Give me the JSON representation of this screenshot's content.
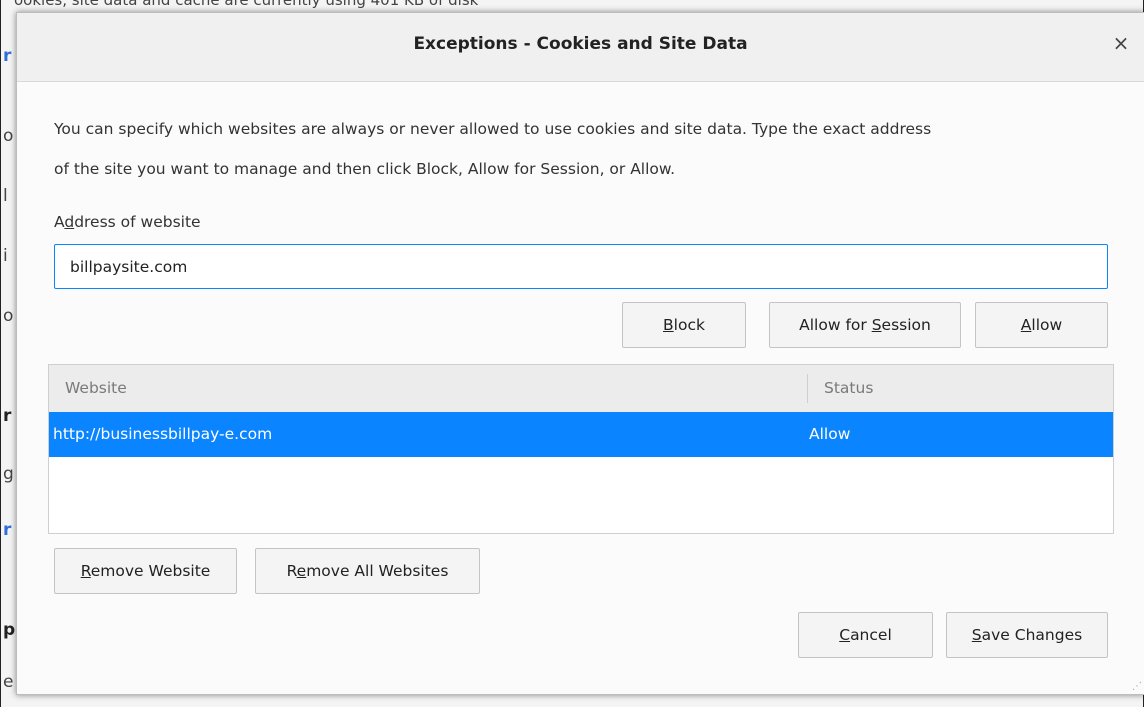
{
  "background": {
    "top_text": "ookies, site data and cache are currently using 401 KB of disk",
    "fragments": [
      "r",
      "o",
      "l",
      "i",
      "o",
      "r",
      "g",
      "r",
      "p",
      "e"
    ]
  },
  "dialog": {
    "title": "Exceptions - Cookies and Site Data",
    "close_glyph": "×",
    "description_line1": "You can specify which websites are always or never allowed to use cookies and site data. Type the exact address",
    "description_line2": "of the site you want to manage and then click Block, Allow for Session, or Allow.",
    "address_label_prefix": "A",
    "address_label_ul": "d",
    "address_label_suffix": "dress of website",
    "address_value": "billpaysite.com",
    "buttons": {
      "block_ul": "B",
      "block_rest": "lock",
      "session_prefix": "Allow for ",
      "session_ul": "S",
      "session_rest": "ession",
      "allow_ul": "A",
      "allow_rest": "llow"
    },
    "table": {
      "col_website": "Website",
      "col_status": "Status",
      "rows": [
        {
          "website": "http://businessbillpay-e.com",
          "status": "Allow"
        }
      ]
    },
    "remove_website_ul": "R",
    "remove_website_rest": "emove Website",
    "remove_all_prefix": "R",
    "remove_all_ul": "e",
    "remove_all_rest": "move All Websites",
    "cancel_ul": "C",
    "cancel_rest": "ancel",
    "save_ul": "S",
    "save_rest": "ave Changes",
    "resize_glyph": "⋰"
  },
  "colors": {
    "accent": "#0a84ff",
    "selected_row": "#0a84ff"
  }
}
